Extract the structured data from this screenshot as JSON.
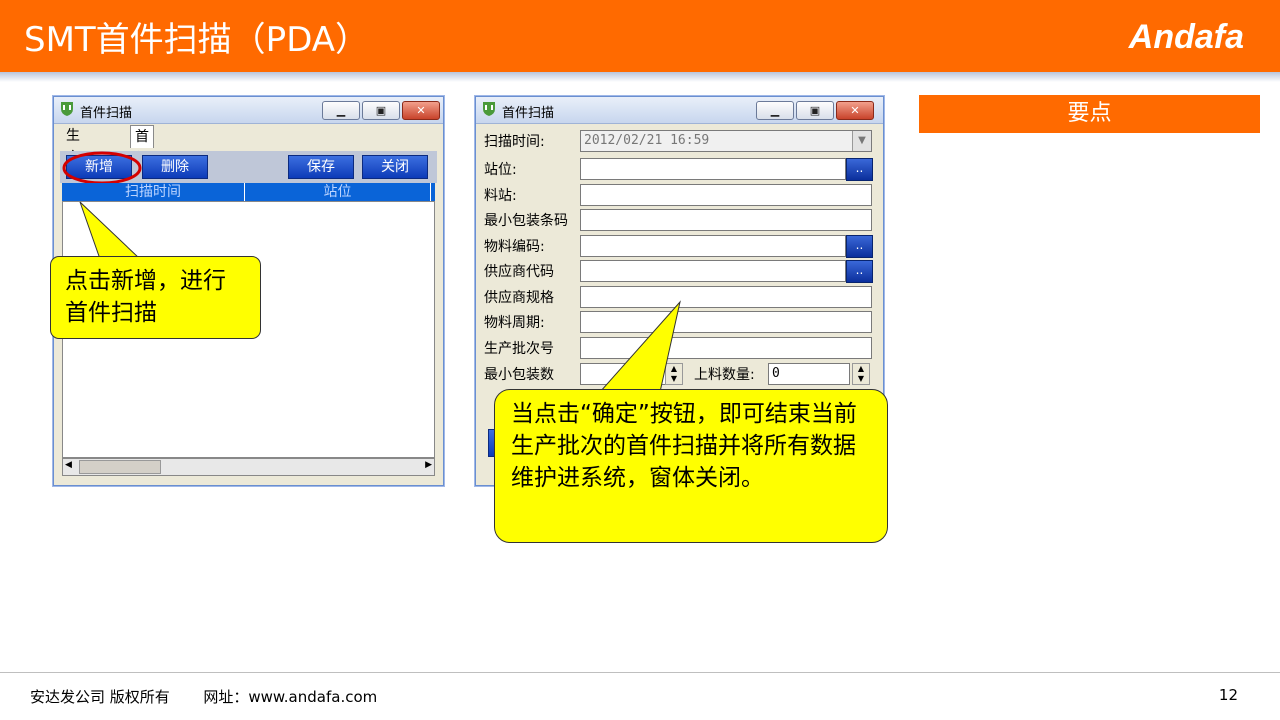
{
  "slide": {
    "title": "SMT首件扫描（PDA）",
    "logo": "Andafa",
    "keypoint_label": "要点"
  },
  "colors": {
    "brand": "#ff6a00",
    "callout": "#ffff00",
    "button_blue": "#0d3bb8"
  },
  "window_left": {
    "title": "首件扫描",
    "tabs": [
      "生产批次",
      "首件扫描"
    ],
    "active_tab": "首件扫描",
    "buttons": {
      "add": "新增",
      "delete": "删除",
      "save": "保存",
      "close": "关闭"
    },
    "columns": [
      "扫描时间",
      "站位"
    ]
  },
  "window_right": {
    "title": "首件扫描",
    "fields": {
      "scan_time": {
        "label": "扫描时间:",
        "value": "2012/02/21 16:59"
      },
      "station": {
        "label": "站位:"
      },
      "feeder": {
        "label": "料站:"
      },
      "min_pack_barcode": {
        "label": "最小包装条码"
      },
      "material_code": {
        "label": "物料编码:"
      },
      "supplier_code": {
        "label": "供应商代码"
      },
      "supplier_spec": {
        "label": "供应商规格"
      },
      "material_period": {
        "label": "物料周期:"
      },
      "production_batch": {
        "label": "生产批次号"
      },
      "min_pack_qty": {
        "label": "最小包装数"
      },
      "load_qty": {
        "label": "上料数量:",
        "value": "0"
      }
    }
  },
  "callouts": {
    "left": "点击新增，进行首件扫描",
    "right": "当点击“确定”按钮，即可结束当前生产批次的首件扫描并将所有数据维护进系统，窗体关闭。"
  },
  "footer": {
    "copyright": "安达发公司 版权所有",
    "website_label": "网址：",
    "website": "www.andafa.com",
    "page_number": "12"
  }
}
